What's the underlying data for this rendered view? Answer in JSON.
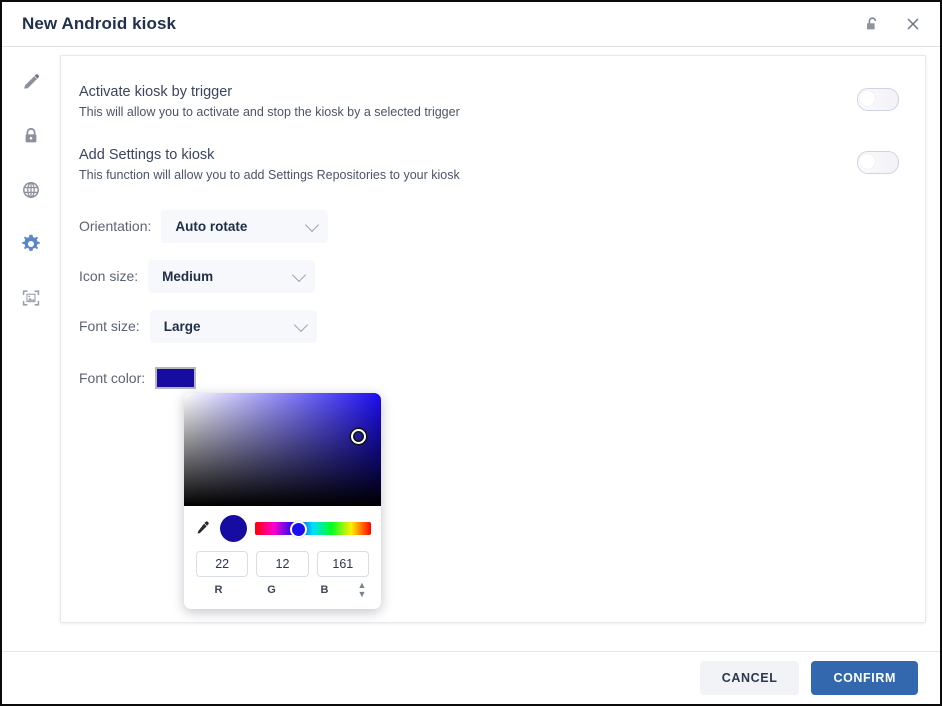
{
  "header": {
    "title": "New Android kiosk",
    "lock_icon": "unlocked-padlock-icon",
    "close_icon": "close-icon"
  },
  "sidebar": {
    "items": [
      {
        "name": "edit",
        "icon": "pencil-icon",
        "active": false
      },
      {
        "name": "security",
        "icon": "lock-icon",
        "active": false
      },
      {
        "name": "network",
        "icon": "globe-icon",
        "active": false
      },
      {
        "name": "settings",
        "icon": "gear-icon",
        "active": true
      },
      {
        "name": "wallpaper",
        "icon": "image-frame-icon",
        "active": false
      }
    ]
  },
  "main": {
    "toggles": [
      {
        "title": "Activate kiosk by trigger",
        "description": "This will allow you to activate and stop the kiosk by a selected trigger",
        "state": "off"
      },
      {
        "title": "Add Settings to kiosk",
        "description": "This function will allow you to add Settings Repositories to your kiosk",
        "state": "off"
      }
    ],
    "fields": [
      {
        "label": "Orientation:",
        "value": "Auto rotate"
      },
      {
        "label": "Icon size:",
        "value": "Medium"
      },
      {
        "label": "Font size:",
        "value": "Large"
      }
    ],
    "font_color": {
      "label": "Font color:",
      "swatch_hex": "#160ca1",
      "picker": {
        "eyedropper_icon": "eyedropper-icon",
        "preview_hex": "#160ca1",
        "r_value": "22",
        "g_value": "12",
        "b_value": "161",
        "r_label": "R",
        "g_label": "G",
        "b_label": "B",
        "stepper_icon": "up-down-stepper-icon"
      }
    }
  },
  "footer": {
    "cancel_label": "CANCEL",
    "confirm_label": "CONFIRM"
  },
  "colors": {
    "accent_blue": "#3468ae",
    "active_icon_blue": "#5b86c8",
    "title_navy": "#21314d",
    "selected_color": "#160ca1"
  }
}
